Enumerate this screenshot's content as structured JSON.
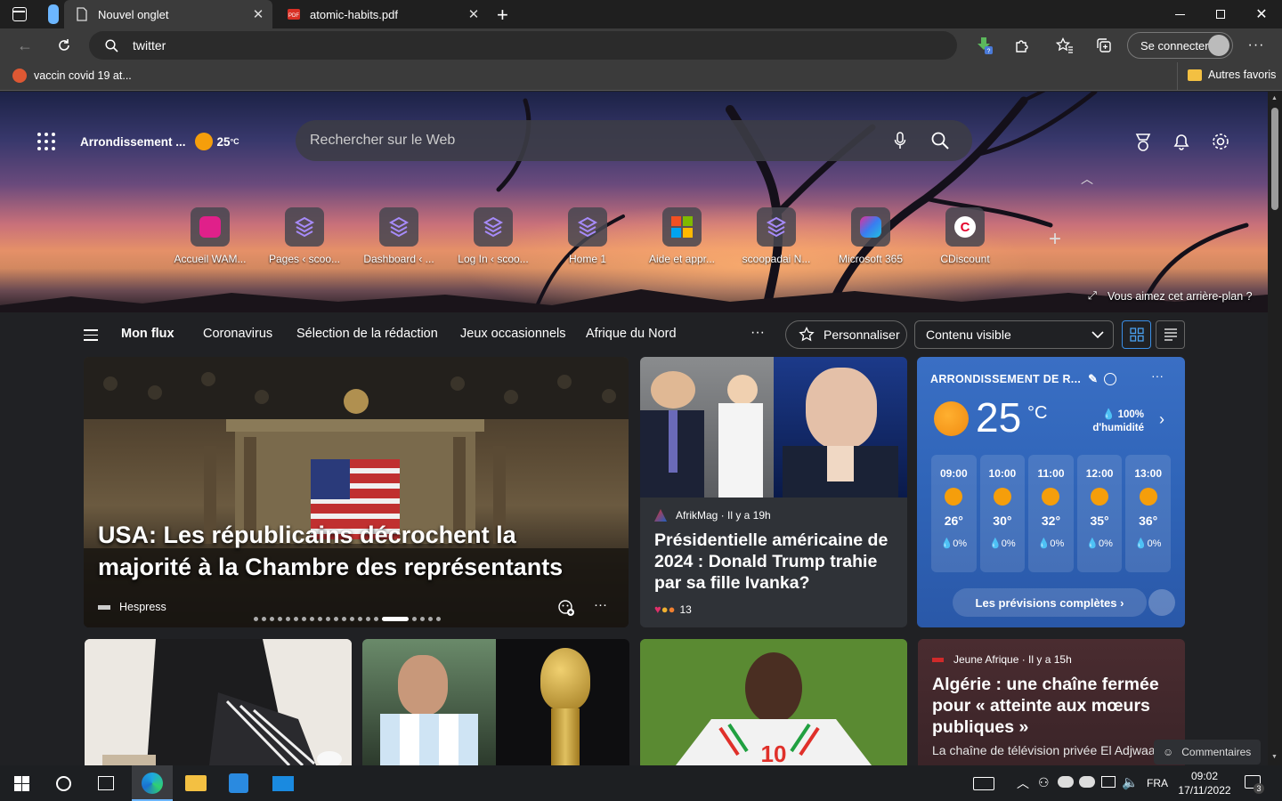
{
  "browser": {
    "tabs": [
      {
        "title": "Nouvel onglet"
      },
      {
        "title": "atomic-habits.pdf"
      }
    ],
    "address": "twitter",
    "signin_label": "Se connecter",
    "favorites": {
      "item": "vaccin covid 19 at...",
      "other": "Autres favoris"
    }
  },
  "newtab": {
    "location": "Arrondissement ...",
    "temp": "25",
    "temp_unit": "°C",
    "search_placeholder": "Rechercher sur le Web",
    "quicklinks": [
      {
        "label": "Accueil WAM...",
        "icon": "wam-icon"
      },
      {
        "label": "Pages ‹ scoo...",
        "icon": "scoopadai-icon"
      },
      {
        "label": "Dashboard ‹ ...",
        "icon": "scoopadai-icon"
      },
      {
        "label": "Log In ‹ scoo...",
        "icon": "scoopadai-icon"
      },
      {
        "label": "Home 1",
        "icon": "scoopadai-icon"
      },
      {
        "label": "Aide et appr...",
        "icon": "microsoft-icon"
      },
      {
        "label": "scoopadai N...",
        "icon": "scoopadai-icon"
      },
      {
        "label": "Microsoft 365",
        "icon": "m365-icon"
      },
      {
        "label": "CDiscount",
        "icon": "cdiscount-icon"
      }
    ],
    "background_prompt": "Vous aimez cet arrière-plan ?",
    "nav": {
      "items": [
        "Mon flux",
        "Coronavirus",
        "Sélection de la rédaction",
        "Jeux occasionnels",
        "Afrique du Nord"
      ],
      "more": "···",
      "personalize": "Personnaliser",
      "content_select": "Contenu visible"
    },
    "featured": {
      "title": "USA: Les républicains décrochent la majorité à la Chambre des représentants",
      "source": "Hespress"
    },
    "card2": {
      "source": "AfrikMag · Il y a 19h",
      "title": "Présidentielle américaine de 2024 : Donald Trump trahie par sa fille Ivanka?",
      "reactions": "13"
    },
    "weather": {
      "location": "ARRONDISSEMENT DE R...",
      "temp": "25",
      "unit": "°C",
      "humidity_value": "100%",
      "humidity_label": "d'humidité",
      "hours": [
        {
          "time": "09:00",
          "temp": "26°",
          "rain": "0%"
        },
        {
          "time": "10:00",
          "temp": "30°",
          "rain": "0%"
        },
        {
          "time": "11:00",
          "temp": "32°",
          "rain": "0%"
        },
        {
          "time": "12:00",
          "temp": "35°",
          "rain": "0%"
        },
        {
          "time": "13:00",
          "temp": "36°",
          "rain": "0%"
        }
      ],
      "forecast_button": "Les prévisions complètes ›"
    },
    "card_algeria": {
      "source": "Jeune Afrique · Il y a 15h",
      "title": "Algérie : une chaîne fermée pour « atteinte aux mœurs publiques »",
      "snippet": "La chaîne de télévision privée El Adjwaa"
    },
    "feedback": "Commentaires"
  },
  "taskbar": {
    "lang": "FRA",
    "time": "09:02",
    "date": "17/11/2022",
    "notif_count": "3"
  },
  "colors": {
    "accent": "#0078d4",
    "weather_bg": "#2f64b8"
  }
}
